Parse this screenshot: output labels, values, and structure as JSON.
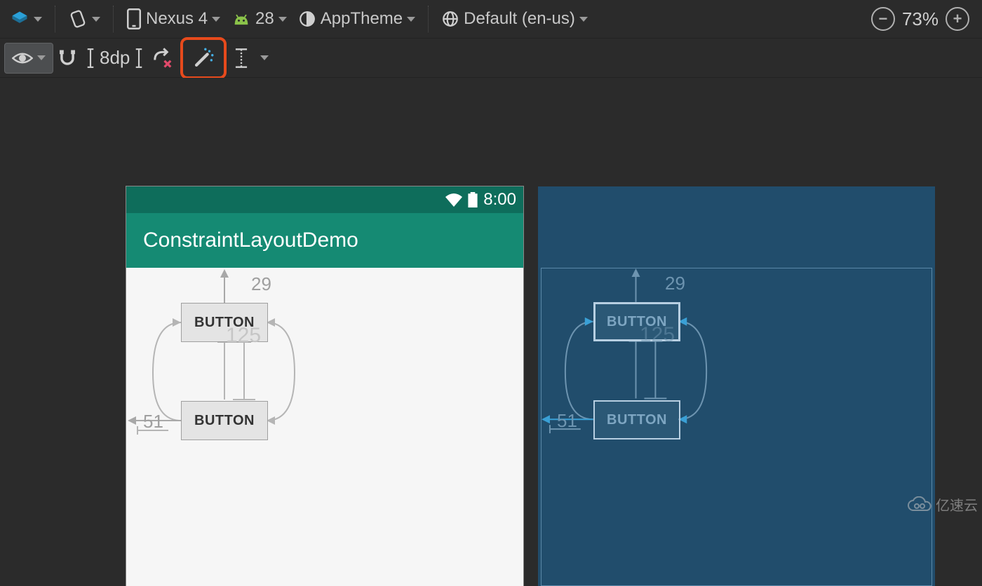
{
  "toolbar": {
    "device_label": "Nexus 4",
    "api_label": "28",
    "theme_label": "AppTheme",
    "locale_label": "Default (en-us)",
    "zoom_label": "73%",
    "margin_label": "8dp"
  },
  "preview": {
    "status_time": "8:00",
    "app_title": "ConstraintLayoutDemo",
    "button1_label": "BUTTON",
    "button2_label": "BUTTON",
    "margin_top": "29",
    "margin_left": "51",
    "center_dim": "125"
  },
  "blueprint": {
    "button1_label": "BUTTON",
    "button2_label": "BUTTON",
    "margin_top": "29",
    "margin_left": "51",
    "center_dim": "125"
  },
  "watermark_text": "亿速云"
}
